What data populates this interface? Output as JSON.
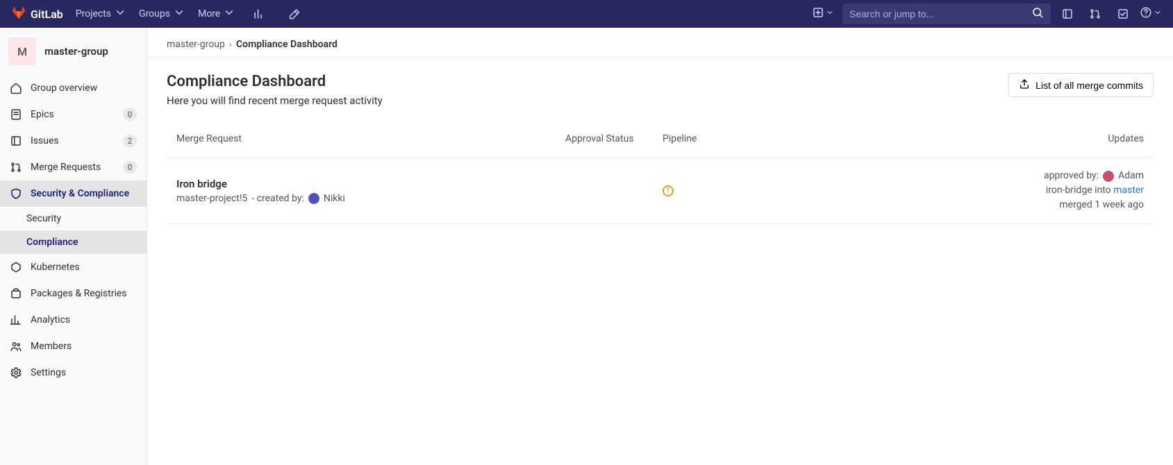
{
  "navbar": {
    "brand": "GitLab",
    "menu": {
      "projects": "Projects",
      "groups": "Groups",
      "more": "More"
    },
    "search_placeholder": "Search or jump to..."
  },
  "sidebar": {
    "group_initial": "M",
    "group_name": "master-group",
    "items": [
      {
        "label": "Group overview",
        "badge": null
      },
      {
        "label": "Epics",
        "badge": "0"
      },
      {
        "label": "Issues",
        "badge": "2"
      },
      {
        "label": "Merge Requests",
        "badge": "0"
      },
      {
        "label": "Security & Compliance",
        "badge": null,
        "active": true,
        "children": [
          {
            "label": "Security",
            "active": false
          },
          {
            "label": "Compliance",
            "active": true
          }
        ]
      },
      {
        "label": "Kubernetes",
        "badge": null
      },
      {
        "label": "Packages & Registries",
        "badge": null
      },
      {
        "label": "Analytics",
        "badge": null
      },
      {
        "label": "Members",
        "badge": null
      },
      {
        "label": "Settings",
        "badge": null
      }
    ]
  },
  "breadcrumb": {
    "root": "master-group",
    "current": "Compliance Dashboard"
  },
  "page": {
    "title": "Compliance Dashboard",
    "description": "Here you will find recent merge request activity",
    "export_button": "List of all merge commits"
  },
  "table": {
    "headers": {
      "mr": "Merge Request",
      "approval": "Approval Status",
      "pipeline": "Pipeline",
      "updates": "Updates"
    },
    "rows": [
      {
        "title": "Iron bridge",
        "ref": "master-project!5",
        "created_by_label": " - created by:",
        "creator": "Nikki",
        "approved_by_label": "approved by:",
        "approver": "Adam",
        "merge_source": "iron-bridge into ",
        "merge_target": "master",
        "merged_text": "merged 1 week ago"
      }
    ]
  }
}
